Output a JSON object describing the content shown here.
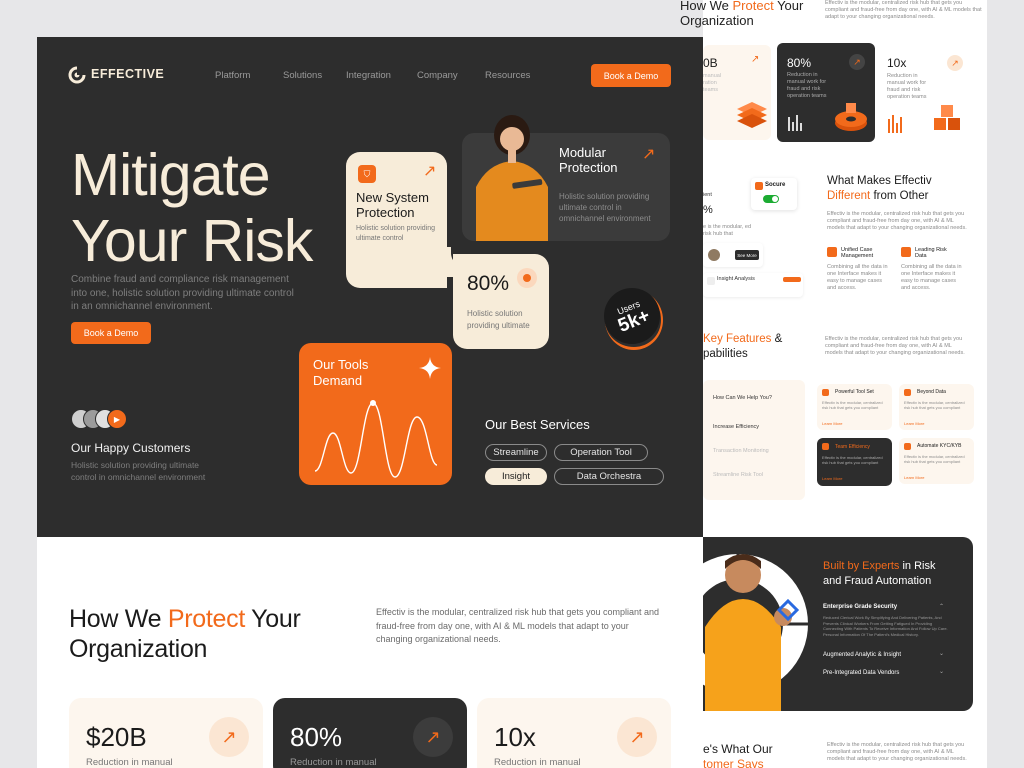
{
  "brand": {
    "name": "EFFECTIVE"
  },
  "nav": {
    "items": [
      "Platform",
      "Solutions",
      "Integration",
      "Company",
      "Resources"
    ],
    "cta": "Book a Demo"
  },
  "hero": {
    "title_line1": "Mitigate",
    "title_line2": "Your Risk",
    "subtitle": "Combine fraud and compliance risk management into one, holistic solution providing ultimate control in an omnichannel environment.",
    "cta": "Book a Demo",
    "customers_title": "Our Happy Customers",
    "customers_sub": "Holistic solution providing ultimate control in omnichannel environment"
  },
  "cards": {
    "new_system": {
      "title": "New System Protection",
      "desc": "Holistic solution providing ultimate control"
    },
    "modular": {
      "title": "Modular Protection",
      "desc": "Holistic solution providing ultimate control in omnichannel environment"
    },
    "eighty": {
      "value": "80%",
      "desc": "Holistic solution providing ultimate"
    },
    "users": {
      "label": "Users",
      "value": "5k+"
    },
    "tools": {
      "title": "Our Tools Demand"
    },
    "services": {
      "title": "Our Best Services",
      "pills": [
        "Streamline",
        "Operation Tool",
        "Insight",
        "Data Orchestra"
      ]
    }
  },
  "protect": {
    "title_a": "How We ",
    "title_b": "Protect",
    "title_c": " Your",
    "title_d": "Organization",
    "desc": "Effectiv is the modular, centralized risk hub that gets you compliant and fraud-free from day one, with AI & ML models that adapt to your changing organizational needs.",
    "stats": [
      {
        "value": "$20B",
        "label": "Reduction in manual"
      },
      {
        "value": "80%",
        "label": "Reduction in manual"
      },
      {
        "value": "10x",
        "label": "Reduction in manual"
      }
    ]
  },
  "right": {
    "protect_a": "How We ",
    "protect_b": "Protect",
    "protect_c": " Your",
    "protect_d": "Organization",
    "protect_desc": "Effectiv is the modular, centralized risk hub that gets you compliant and fraud-free from day one, with AI & ML models that adapt to your changing organizational needs.",
    "stat_a": "0B",
    "stat_b": "80%",
    "stat_c": "10x",
    "stat_desc": "Reduction in manual work for fraud and risk operation teams",
    "makes_a": "What Makes Effectiv",
    "makes_b": "Different",
    "makes_c": " from Other",
    "makes_desc": "Effectiv is the modular, centralized risk hub that gets you compliant and fraud-free from day one, with AI & ML models that adapt to your changing organizational needs.",
    "secure": "Socure",
    "see_more": "See More",
    "insight_analysis": "Insight Analysis",
    "unified": "Unified Case Management",
    "leading": "Leading Risk Data",
    "unified_desc": "Combining all the data in one Interface makes it easy to manage cases and access.",
    "leading_desc": "Combining all the data in one Interface makes it easy to manage cases and access.",
    "features_a": "Key Features",
    "features_b": " &",
    "features_c": "pabilities",
    "features_desc": "Effectiv is the modular, centralized risk hub that gets you compliant and fraud-free from day one, with AI & ML models that adapt to your changing organizational needs.",
    "help": "How Can We Help You?",
    "menu": [
      "Increase Efficiency",
      "Transaction Monitoring",
      "Streamline Risk Tool"
    ],
    "features": [
      "Powerful Tool Set",
      "Beyond Data",
      "Team Efficiency",
      "Automate KYC/KYB"
    ],
    "learn_more": "Learn More",
    "experts_a": "Built by Experts",
    "experts_b": " in Risk and Fraud Automation",
    "accordion": [
      "Enterprise Grade Security",
      "Augmented Analytic & Insight",
      "Pre-Integrated Data Vendors"
    ],
    "accordion_desc": "Reduced Clerical Work By Simplifying And Delivering Patients, And Prevents Clinical Workers From Getting Fatigued In Providing Connecting With Patients To Receive Information And Follow Up Care. Personal Information Of The Patient's Medical History.",
    "testimonial_a": "e's What Our",
    "testimonial_b": "tomer Says"
  }
}
